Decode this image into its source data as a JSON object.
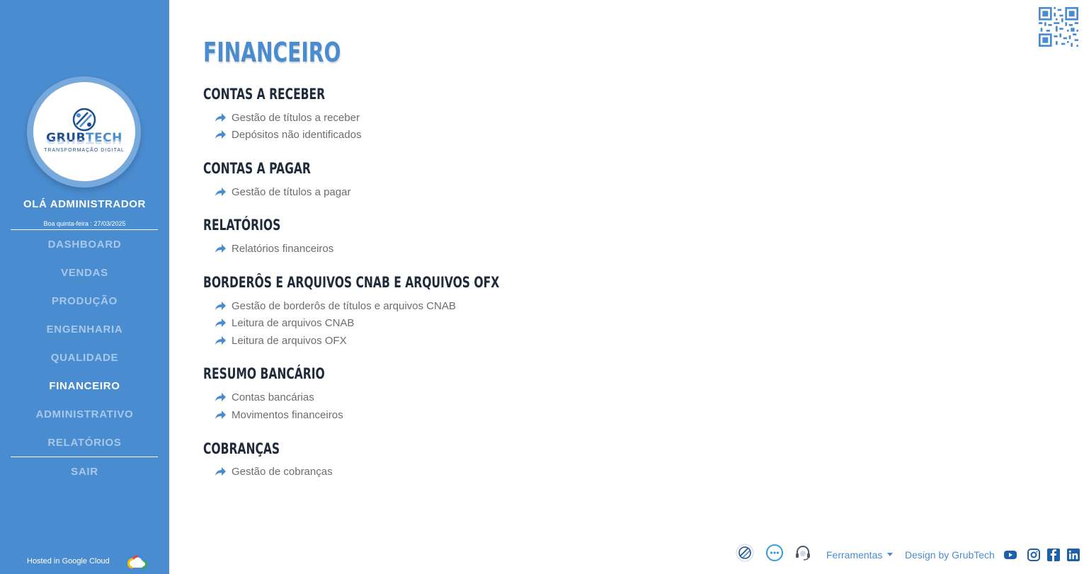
{
  "sidebar": {
    "logo_text_main": "GRUB",
    "logo_text_accent": "TECH",
    "logo_tagline": "TRANSFORMAÇÃO DIGITAL",
    "greeting": "OLÁ ADMINISTRADOR",
    "date": "Boa quinta-feira : 27/03/2025",
    "nav": [
      {
        "label": "DASHBOARD",
        "active": false
      },
      {
        "label": "VENDAS",
        "active": false
      },
      {
        "label": "PRODUÇÃO",
        "active": false
      },
      {
        "label": "ENGENHARIA",
        "active": false
      },
      {
        "label": "QUALIDADE",
        "active": false
      },
      {
        "label": "FINANCEIRO",
        "active": true
      },
      {
        "label": "ADMINISTRATIVO",
        "active": false
      },
      {
        "label": "RELATÓRIOS",
        "active": false
      }
    ],
    "logout": "SAIR",
    "hosted": "Hosted in Google Cloud"
  },
  "main": {
    "title": "FINANCEIRO",
    "sections": [
      {
        "title": "CONTAS A RECEBER",
        "links": [
          "Gestão de títulos a receber",
          "Depósitos não identificados"
        ]
      },
      {
        "title": "CONTAS A PAGAR",
        "links": [
          "Gestão de títulos a pagar"
        ]
      },
      {
        "title": "RELATÓRIOS",
        "links": [
          "Relatórios financeiros"
        ]
      },
      {
        "title": "BORDERÔS E ARQUIVOS CNAB E ARQUIVOS OFX",
        "links": [
          "Gestão de borderôs de títulos e arquivos CNAB",
          "Leitura de arquivos CNAB",
          "Leitura de arquivos OFX"
        ]
      },
      {
        "title": "RESUMO BANCÁRIO",
        "links": [
          "Contas bancárias",
          "Movimentos financeiros"
        ]
      },
      {
        "title": "COBRANÇAS",
        "links": [
          "Gestão de cobranças"
        ]
      }
    ]
  },
  "footer": {
    "tools_label": "Ferramentas",
    "design_label": "Design by GrubTech",
    "icons": [
      "grubtech-icon",
      "chat-icon",
      "support-headset-icon"
    ],
    "social": [
      "youtube-icon",
      "instagram-icon",
      "facebook-icon",
      "linkedin-icon"
    ]
  },
  "colors": {
    "sidebar": "#4a8cd0",
    "nav_inactive": "#a7c8ec",
    "accent": "#4a8cd0",
    "heading": "#1f2b3a",
    "link": "#6d6d6d"
  }
}
